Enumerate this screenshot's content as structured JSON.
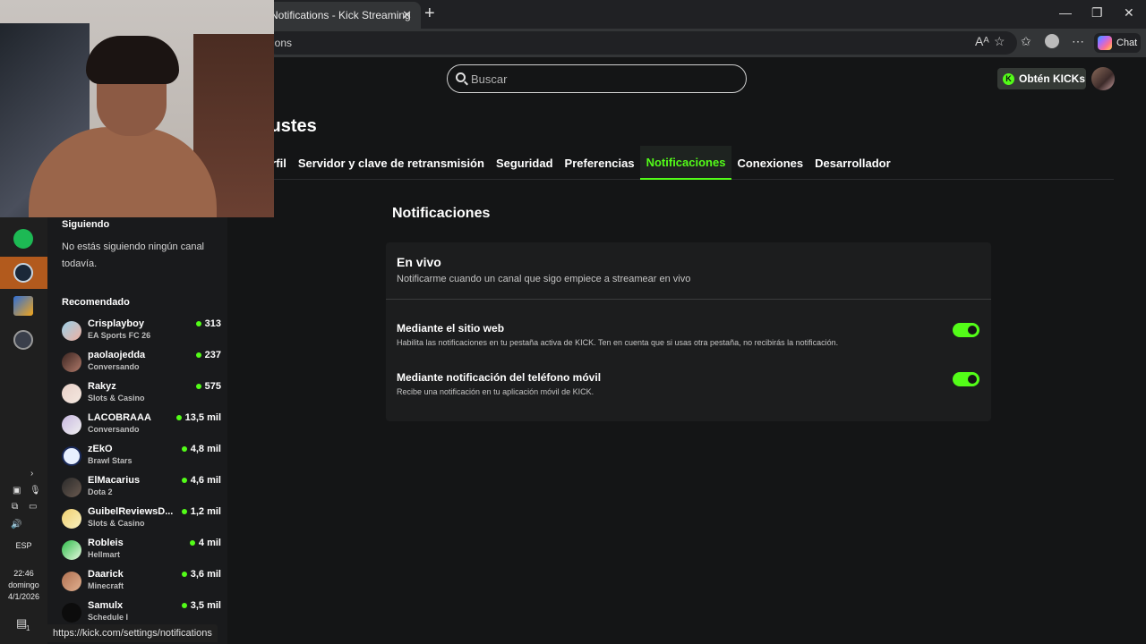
{
  "browser": {
    "tab_title": "Notifications - Kick Streaming",
    "url_visible": "ions",
    "chat_label": "Chat",
    "status_url": "https://kick.com/settings/notifications"
  },
  "header": {
    "search_placeholder": "Buscar",
    "kicks_button": "Obtén KICKs"
  },
  "settings": {
    "title": "justes",
    "tabs": [
      {
        "label": "erfil",
        "active": false
      },
      {
        "label": "Servidor y clave de retransmisión",
        "active": false
      },
      {
        "label": "Seguridad",
        "active": false
      },
      {
        "label": "Preferencias",
        "active": false
      },
      {
        "label": "Notificaciones",
        "active": true
      },
      {
        "label": "Conexiones",
        "active": false
      },
      {
        "label": "Desarrollador",
        "active": false
      }
    ],
    "section_title": "Notificaciones",
    "card": {
      "title": "En vivo",
      "subtitle": "Notificarme cuando un canal que sigo empiece a streamear en vivo",
      "options": [
        {
          "label": "Mediante el sitio web",
          "description": "Habilita las notificaciones en tu pestaña activa de KICK. Ten en cuenta que si usas otra pestaña, no recibirás la notificación.",
          "enabled": true
        },
        {
          "label": "Mediante notificación del teléfono móvil",
          "description": "Recibe una notificación en tu aplicación móvil de KICK.",
          "enabled": true
        }
      ]
    }
  },
  "sidebar": {
    "following_heading": "Siguiendo",
    "following_empty": "No estás siguiendo ningún canal todavía.",
    "recommended_heading": "Recomendado",
    "channels": [
      {
        "name": "Crisplayboy",
        "category": "EA Sports FC 26",
        "viewers": "313"
      },
      {
        "name": "paolaojedda",
        "category": "Conversando",
        "viewers": "237"
      },
      {
        "name": "Rakyz",
        "category": "Slots & Casino",
        "viewers": "575"
      },
      {
        "name": "LACOBRAAA",
        "category": "Conversando",
        "viewers": "13,5 mil"
      },
      {
        "name": "zEkO",
        "category": "Brawl Stars",
        "viewers": "4,8 mil"
      },
      {
        "name": "ElMacarius",
        "category": "Dota 2",
        "viewers": "4,6 mil"
      },
      {
        "name": "GuibelReviewsD...",
        "category": "Slots & Casino",
        "viewers": "1,2 mil"
      },
      {
        "name": "Robleis",
        "category": "Hellmart",
        "viewers": "4 mil"
      },
      {
        "name": "Daarick",
        "category": "Minecraft",
        "viewers": "3,6 mil"
      },
      {
        "name": "Samulx",
        "category": "Schedule I",
        "viewers": "3,5 mil"
      }
    ]
  },
  "taskbar": {
    "language": "ESP",
    "time": "22:46",
    "day": "domingo",
    "date": "4/1/2026",
    "notification_count": "1"
  },
  "colors": {
    "accent": "#53fc18",
    "background": "#141516",
    "card": "#1c1d1e"
  }
}
